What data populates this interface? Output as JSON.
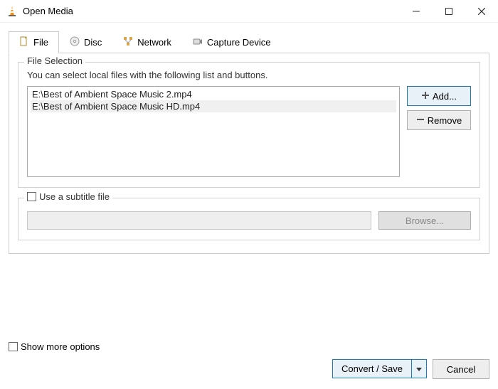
{
  "titlebar": {
    "title": "Open Media"
  },
  "tabs": {
    "file": "File",
    "disc": "Disc",
    "network": "Network",
    "capture": "Capture Device"
  },
  "fileSelection": {
    "legend": "File Selection",
    "desc": "You can select local files with the following list and buttons.",
    "files": [
      "E:\\Best of Ambient Space Music 2.mp4",
      "E:\\Best of Ambient Space Music HD.mp4"
    ],
    "addLabel": "Add...",
    "removeLabel": "Remove"
  },
  "subtitle": {
    "label": "Use a subtitle file",
    "browse": "Browse..."
  },
  "footer": {
    "showMore": "Show more options",
    "convert": "Convert / Save",
    "cancel": "Cancel"
  }
}
